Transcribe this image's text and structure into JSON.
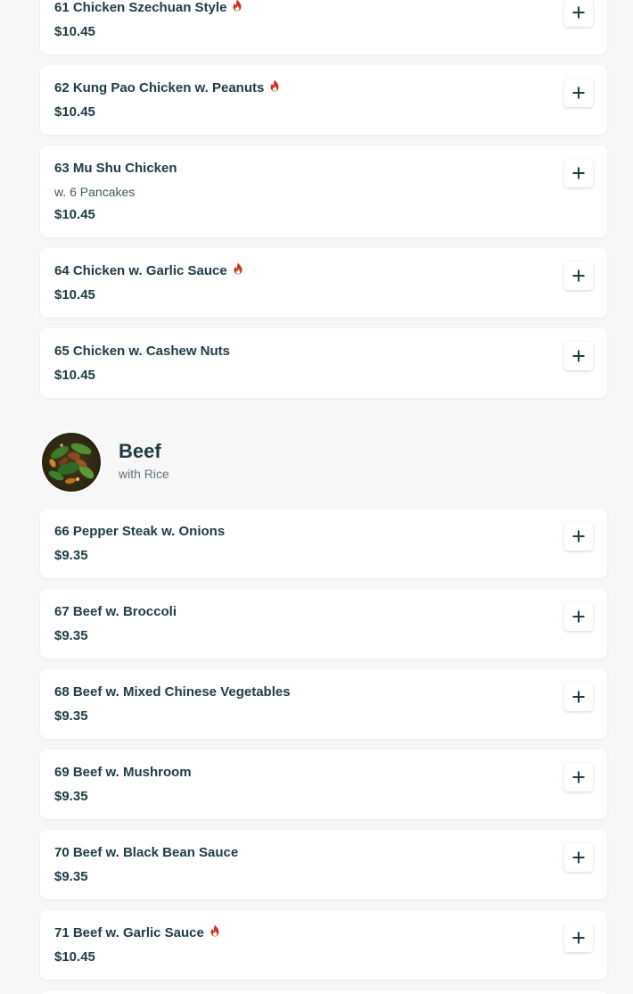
{
  "section_beef": {
    "title": "Beef",
    "subtitle": "with Rice"
  },
  "items": [
    {
      "name": "61 Chicken Szechuan Style",
      "price": "$10.45",
      "spicy": true
    },
    {
      "name": "62 Kung Pao Chicken w. Peanuts",
      "price": "$10.45",
      "spicy": true
    },
    {
      "name": "63 Mu Shu Chicken",
      "desc": "w. 6 Pancakes",
      "price": "$10.45",
      "spicy": false
    },
    {
      "name": "64 Chicken w. Garlic Sauce",
      "price": "$10.45",
      "spicy": true
    },
    {
      "name": "65 Chicken w. Cashew Nuts",
      "price": "$10.45",
      "spicy": false
    },
    {
      "name": "66 Pepper Steak w. Onions",
      "price": "$9.35",
      "spicy": false
    },
    {
      "name": "67 Beef w. Broccoli",
      "price": "$9.35",
      "spicy": false
    },
    {
      "name": "68 Beef w. Mixed Chinese Vegetables",
      "price": "$9.35",
      "spicy": false
    },
    {
      "name": "69 Beef w. Mushroom",
      "price": "$9.35",
      "spicy": false
    },
    {
      "name": "70 Beef w. Black Bean Sauce",
      "price": "$9.35",
      "spicy": false
    },
    {
      "name": "71 Beef w. Garlic Sauce",
      "price": "$10.45",
      "spicy": true
    }
  ],
  "colors": {
    "text": "#1d3b44",
    "spicy": "#c8361e",
    "background": "#f7f7f7",
    "card": "#ffffff"
  },
  "icons": {
    "add": "plus-icon",
    "spicy": "flame-icon"
  }
}
